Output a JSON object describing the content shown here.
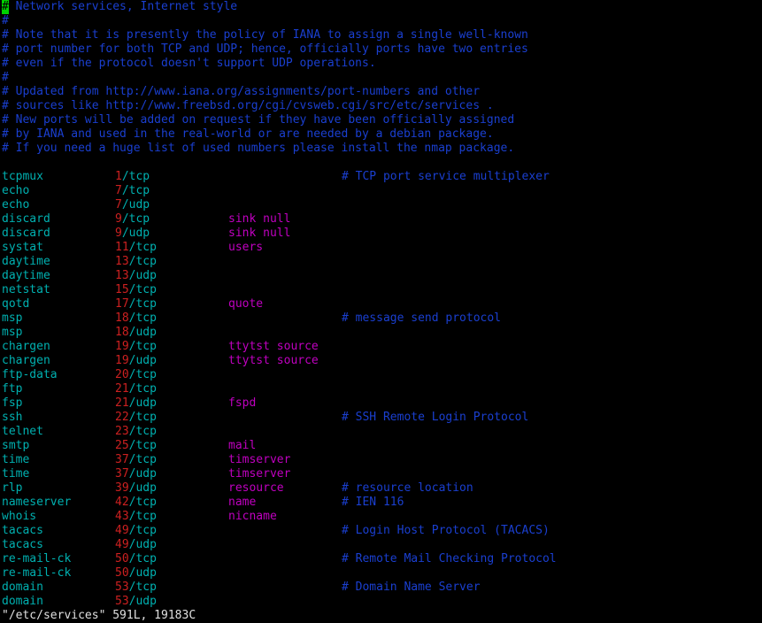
{
  "header_comments": [
    "# Network services, Internet style",
    "#",
    "# Note that it is presently the policy of IANA to assign a single well-known",
    "# port number for both TCP and UDP; hence, officially ports have two entries",
    "# even if the protocol doesn't support UDP operations.",
    "#",
    "# Updated from http://www.iana.org/assignments/port-numbers and other",
    "# sources like http://www.freebsd.org/cgi/cvsweb.cgi/src/etc/services .",
    "# New ports will be added on request if they have been officially assigned",
    "# by IANA and used in the real-world or are needed by a debian package.",
    "# If you need a huge list of used numbers please install the nmap package."
  ],
  "services": [
    {
      "name": "tcpmux",
      "port": "1",
      "proto": "/tcp",
      "aliases": "",
      "comment": "# TCP port service multiplexer"
    },
    {
      "name": "echo",
      "port": "7",
      "proto": "/tcp",
      "aliases": "",
      "comment": ""
    },
    {
      "name": "echo",
      "port": "7",
      "proto": "/udp",
      "aliases": "",
      "comment": ""
    },
    {
      "name": "discard",
      "port": "9",
      "proto": "/tcp",
      "aliases": "sink null",
      "comment": ""
    },
    {
      "name": "discard",
      "port": "9",
      "proto": "/udp",
      "aliases": "sink null",
      "comment": ""
    },
    {
      "name": "systat",
      "port": "11",
      "proto": "/tcp",
      "aliases": "users",
      "comment": ""
    },
    {
      "name": "daytime",
      "port": "13",
      "proto": "/tcp",
      "aliases": "",
      "comment": ""
    },
    {
      "name": "daytime",
      "port": "13",
      "proto": "/udp",
      "aliases": "",
      "comment": ""
    },
    {
      "name": "netstat",
      "port": "15",
      "proto": "/tcp",
      "aliases": "",
      "comment": ""
    },
    {
      "name": "qotd",
      "port": "17",
      "proto": "/tcp",
      "aliases": "quote",
      "comment": ""
    },
    {
      "name": "msp",
      "port": "18",
      "proto": "/tcp",
      "aliases": "",
      "comment": "# message send protocol"
    },
    {
      "name": "msp",
      "port": "18",
      "proto": "/udp",
      "aliases": "",
      "comment": ""
    },
    {
      "name": "chargen",
      "port": "19",
      "proto": "/tcp",
      "aliases": "ttytst source",
      "comment": ""
    },
    {
      "name": "chargen",
      "port": "19",
      "proto": "/udp",
      "aliases": "ttytst source",
      "comment": ""
    },
    {
      "name": "ftp-data",
      "port": "20",
      "proto": "/tcp",
      "aliases": "",
      "comment": ""
    },
    {
      "name": "ftp",
      "port": "21",
      "proto": "/tcp",
      "aliases": "",
      "comment": ""
    },
    {
      "name": "fsp",
      "port": "21",
      "proto": "/udp",
      "aliases": "fspd",
      "comment": ""
    },
    {
      "name": "ssh",
      "port": "22",
      "proto": "/tcp",
      "aliases": "",
      "comment": "# SSH Remote Login Protocol"
    },
    {
      "name": "telnet",
      "port": "23",
      "proto": "/tcp",
      "aliases": "",
      "comment": ""
    },
    {
      "name": "smtp",
      "port": "25",
      "proto": "/tcp",
      "aliases": "mail",
      "comment": ""
    },
    {
      "name": "time",
      "port": "37",
      "proto": "/tcp",
      "aliases": "timserver",
      "comment": ""
    },
    {
      "name": "time",
      "port": "37",
      "proto": "/udp",
      "aliases": "timserver",
      "comment": ""
    },
    {
      "name": "rlp",
      "port": "39",
      "proto": "/udp",
      "aliases": "resource",
      "comment": "# resource location"
    },
    {
      "name": "nameserver",
      "port": "42",
      "proto": "/tcp",
      "aliases": "name",
      "comment": "# IEN 116"
    },
    {
      "name": "whois",
      "port": "43",
      "proto": "/tcp",
      "aliases": "nicname",
      "comment": ""
    },
    {
      "name": "tacacs",
      "port": "49",
      "proto": "/tcp",
      "aliases": "",
      "comment": "# Login Host Protocol (TACACS)"
    },
    {
      "name": "tacacs",
      "port": "49",
      "proto": "/udp",
      "aliases": "",
      "comment": ""
    },
    {
      "name": "re-mail-ck",
      "port": "50",
      "proto": "/tcp",
      "aliases": "",
      "comment": "# Remote Mail Checking Protocol"
    },
    {
      "name": "re-mail-ck",
      "port": "50",
      "proto": "/udp",
      "aliases": "",
      "comment": ""
    },
    {
      "name": "domain",
      "port": "53",
      "proto": "/tcp",
      "aliases": "",
      "comment": "# Domain Name Server"
    },
    {
      "name": "domain",
      "port": "53",
      "proto": "/udp",
      "aliases": "",
      "comment": ""
    }
  ],
  "status_line": "\"/etc/services\" 591L, 19183C",
  "colors": {
    "background": "#000000",
    "comment": "#1a3fd0",
    "service_name": "#00b0b0",
    "port": "#cc2020",
    "alias": "#c000c0",
    "cursor": "#00d000",
    "status": "#e0e0e0"
  }
}
